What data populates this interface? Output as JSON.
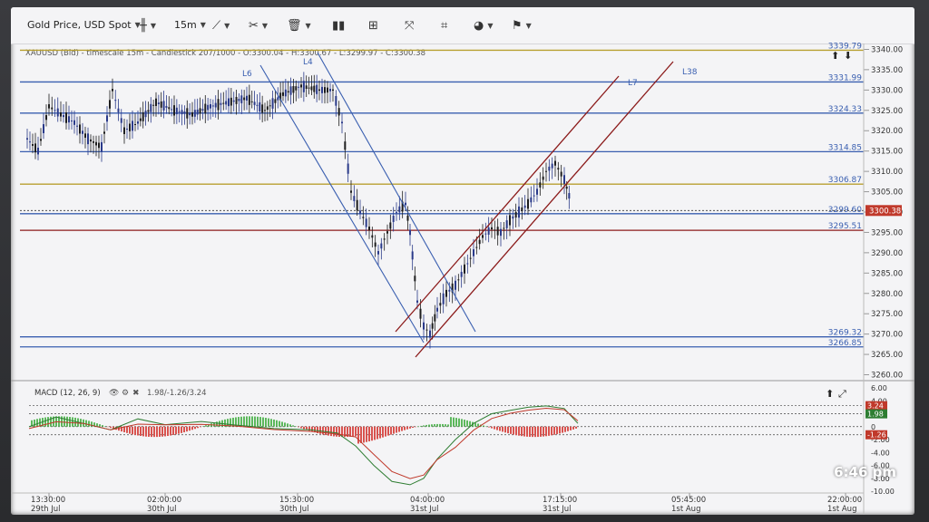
{
  "toolbar": {
    "symbol": "Gold Price, USD Spot",
    "timeframe": "15m",
    "icons": [
      "candlestick-type-icon",
      "line-tool-icon",
      "drawing-tools-icon",
      "trash-icon",
      "bar-chart-icon",
      "grid-layout-icon",
      "fullscreen-icon",
      "crosshair-icon",
      "indicators-icon",
      "flag-icon"
    ]
  },
  "legend": {
    "main": "XAUUSD (Bid) - timescale 15m - Candlestick   207/1000 - O:3300.04 - H:3300.67 - L:3299.97 - C:3300.38"
  },
  "drawing_labels": {
    "l6": "L6",
    "l4": "L4",
    "l7": "L7",
    "l38": "L38"
  },
  "price_axis": {
    "ticks": [
      "3340.00",
      "3335.00",
      "3330.00",
      "3325.00",
      "3320.00",
      "3315.00",
      "3310.00",
      "3305.00",
      "3300.00",
      "3295.00",
      "3290.00",
      "3285.00",
      "3280.00",
      "3275.00",
      "3270.00",
      "3265.00",
      "3260.00"
    ],
    "current_price": "3300.38",
    "current_color": "#c0392b"
  },
  "levels": [
    {
      "value": "3339.79",
      "color": "#b8a030"
    },
    {
      "value": "3331.99",
      "color": "#3a5fb0"
    },
    {
      "value": "3324.33",
      "color": "#3a5fb0"
    },
    {
      "value": "3314.85",
      "color": "#3a5fb0"
    },
    {
      "value": "3306.87",
      "color": "#b8a030"
    },
    {
      "value": "3299.60",
      "color": "#3a5fb0"
    },
    {
      "value": "3295.51",
      "color": "#8b1a1a"
    },
    {
      "value": "3269.32",
      "color": "#3a5fb0"
    },
    {
      "value": "3266.85",
      "color": "#3a5fb0"
    }
  ],
  "macd": {
    "label": "MACD (12, 26, 9)",
    "values": "1.98/-1.26/3.24",
    "axis_ticks": [
      "6.00",
      "4.00",
      "2.00",
      "0",
      "-2.00",
      "-4.00",
      "-6.00",
      "-8.00",
      "-10.00"
    ],
    "badges": [
      {
        "value": "3.24",
        "color": "#c0392b"
      },
      {
        "value": "1.98",
        "color": "#2e7d32"
      },
      {
        "value": "-1.26",
        "color": "#c0392b"
      }
    ]
  },
  "time_axis": [
    {
      "time": "13:30:00",
      "date": "29th Jul"
    },
    {
      "time": "02:00:00",
      "date": "30th Jul"
    },
    {
      "time": "15:30:00",
      "date": "30th Jul"
    },
    {
      "time": "04:00:00",
      "date": "31st Jul"
    },
    {
      "time": "17:15:00",
      "date": "31st Jul"
    },
    {
      "time": "05:45:00",
      "date": "1st Aug"
    },
    {
      "time": "22:00:00",
      "date": "1st Aug"
    }
  ],
  "status": {
    "clock": "6:46 pm"
  },
  "colors": {
    "bull_candle": "#1d1d1d",
    "bear_candle": "#2a3a8a",
    "channel_blue": "#3a5fb0",
    "channel_red": "#8b1a1a",
    "macd_line": "#2e7d32",
    "signal_line": "#c0392b",
    "hist_pos": "#5cb85c",
    "hist_neg": "#d9534f"
  }
}
